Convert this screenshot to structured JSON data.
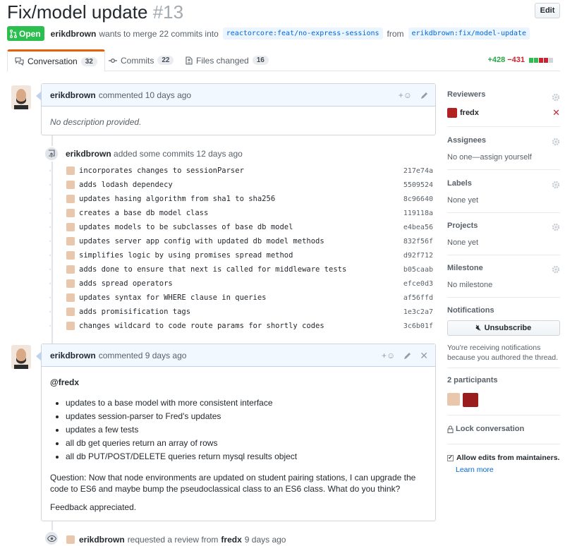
{
  "pr": {
    "title": "Fix/model update",
    "number": "#13",
    "edit_label": "Edit",
    "state": "Open",
    "author": "erikdbrown",
    "merge_text": "wants to merge 22 commits into",
    "base_branch": "reactorcore:feat/no-express-sessions",
    "from_text": "from",
    "head_branch": "erikdbrown:fix/model-update"
  },
  "tabs": [
    {
      "label": "Conversation",
      "count": "32"
    },
    {
      "label": "Commits",
      "count": "22"
    },
    {
      "label": "Files changed",
      "count": "16"
    }
  ],
  "diffstat": {
    "additions": "+428",
    "deletions": "−431"
  },
  "comment1": {
    "author": "erikdbrown",
    "action": "commented 10 days ago",
    "body": "No description provided."
  },
  "commits": {
    "author": "erikdbrown",
    "action": "added some commits 12 days ago",
    "items": [
      {
        "msg": "incorporates changes to sessionParser",
        "sha": "217e74a"
      },
      {
        "msg": "adds lodash dependecy",
        "sha": "5509524"
      },
      {
        "msg": "updates hasing algorithm from sha1 to sha256",
        "sha": "8c96640"
      },
      {
        "msg": "creates a base db model class",
        "sha": "119118a"
      },
      {
        "msg": "updates models to be subclasses of base db model",
        "sha": "e4bea56"
      },
      {
        "msg": "updates server app config with updated db model methods",
        "sha": "832f56f"
      },
      {
        "msg": "simplifies logic by using promises spread method",
        "sha": "d92f712"
      },
      {
        "msg": "adds done to ensure that next is called for middleware tests",
        "sha": "b05caab"
      },
      {
        "msg": "adds spread operators",
        "sha": "efce0d3"
      },
      {
        "msg": "updates syntax for WHERE clause in queries",
        "sha": "af56ffd"
      },
      {
        "msg": "adds promisification tags",
        "sha": "1e3c2a7"
      },
      {
        "msg": "changes wildcard to code route params for shortly codes",
        "sha": "3c6b01f"
      }
    ]
  },
  "comment2": {
    "author": "erikdbrown",
    "action": "commented 9 days ago",
    "mention": "@fredx",
    "bullets": [
      "updates to a base model with more consistent interface",
      "updates session-parser to Fred's updates",
      "updates a few tests",
      "all db get queries return an array of rows",
      "all db PUT/POST/DELETE queries return mysql results object"
    ],
    "question": "Question: Now that node environments are updated on student pairing stations, I can upgrade the code to ES6 and maybe bump the pseudoclassical class to an ES6 class. What do you think?",
    "closing": "Feedback appreciated."
  },
  "review_event": {
    "author": "erikdbrown",
    "action": "requested a review from",
    "reviewer": "fredx",
    "time": "9 days ago"
  },
  "sidebar": {
    "reviewers_title": "Reviewers",
    "reviewer_name": "fredx",
    "assignees_title": "Assignees",
    "assignees_value": "No one—assign yourself",
    "labels_title": "Labels",
    "labels_value": "None yet",
    "projects_title": "Projects",
    "projects_value": "None yet",
    "milestone_title": "Milestone",
    "milestone_value": "No milestone",
    "notifications_title": "Notifications",
    "unsubscribe_label": "Unsubscribe",
    "notif_reason": "You're receiving notifications because you authored the thread.",
    "participants_title": "2 participants",
    "lock_label": "Lock conversation",
    "allow_edits_label": "Allow edits from maintainers.",
    "learn_more": "Learn more"
  },
  "colors": {
    "open": "#2cbe4e",
    "add": "#28a745",
    "del": "#cb2431",
    "link": "#0366d6",
    "tab_accent": "#e36209"
  }
}
